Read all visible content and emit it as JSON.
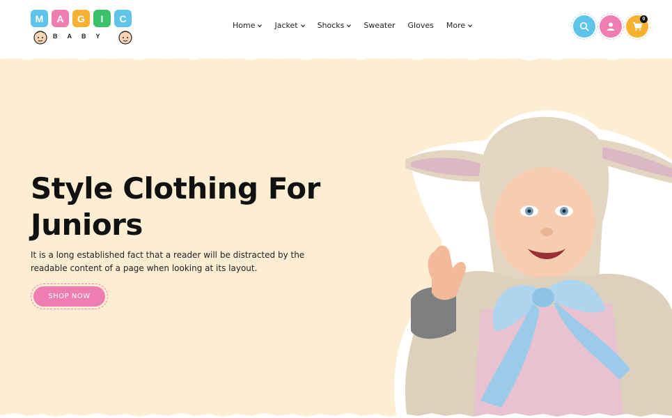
{
  "brand": {
    "letters": [
      "M",
      "A",
      "G",
      "I",
      "C"
    ],
    "letter_colors": [
      "#5fc4ea",
      "#ee7db2",
      "#f5b130",
      "#3cc16b",
      "#5fc4ea"
    ],
    "sub_letters": [
      "B",
      "A",
      "B",
      "Y"
    ]
  },
  "nav": {
    "items": [
      {
        "label": "Home",
        "has_dropdown": true
      },
      {
        "label": "Jacket",
        "has_dropdown": true
      },
      {
        "label": "Shocks",
        "has_dropdown": true
      },
      {
        "label": "Sweater",
        "has_dropdown": false
      },
      {
        "label": "Gloves",
        "has_dropdown": false
      },
      {
        "label": "More",
        "has_dropdown": true
      }
    ]
  },
  "actions": {
    "search_icon": "search-icon",
    "user_icon": "user-icon",
    "cart_icon": "cart-icon",
    "cart_count": "0"
  },
  "hero": {
    "title_line1": "Style Clothing For",
    "title_line2": "Juniors",
    "text_line1": "It is a long established fact that a reader will be distracted by the",
    "text_line2": "readable content of a page when looking at its layout.",
    "cta_label": "SHOP NOW"
  },
  "colors": {
    "hero_bg": "#fdeed3",
    "accent_pink": "#ee7db2",
    "accent_blue": "#5fc4ea",
    "accent_orange": "#f5b130"
  }
}
